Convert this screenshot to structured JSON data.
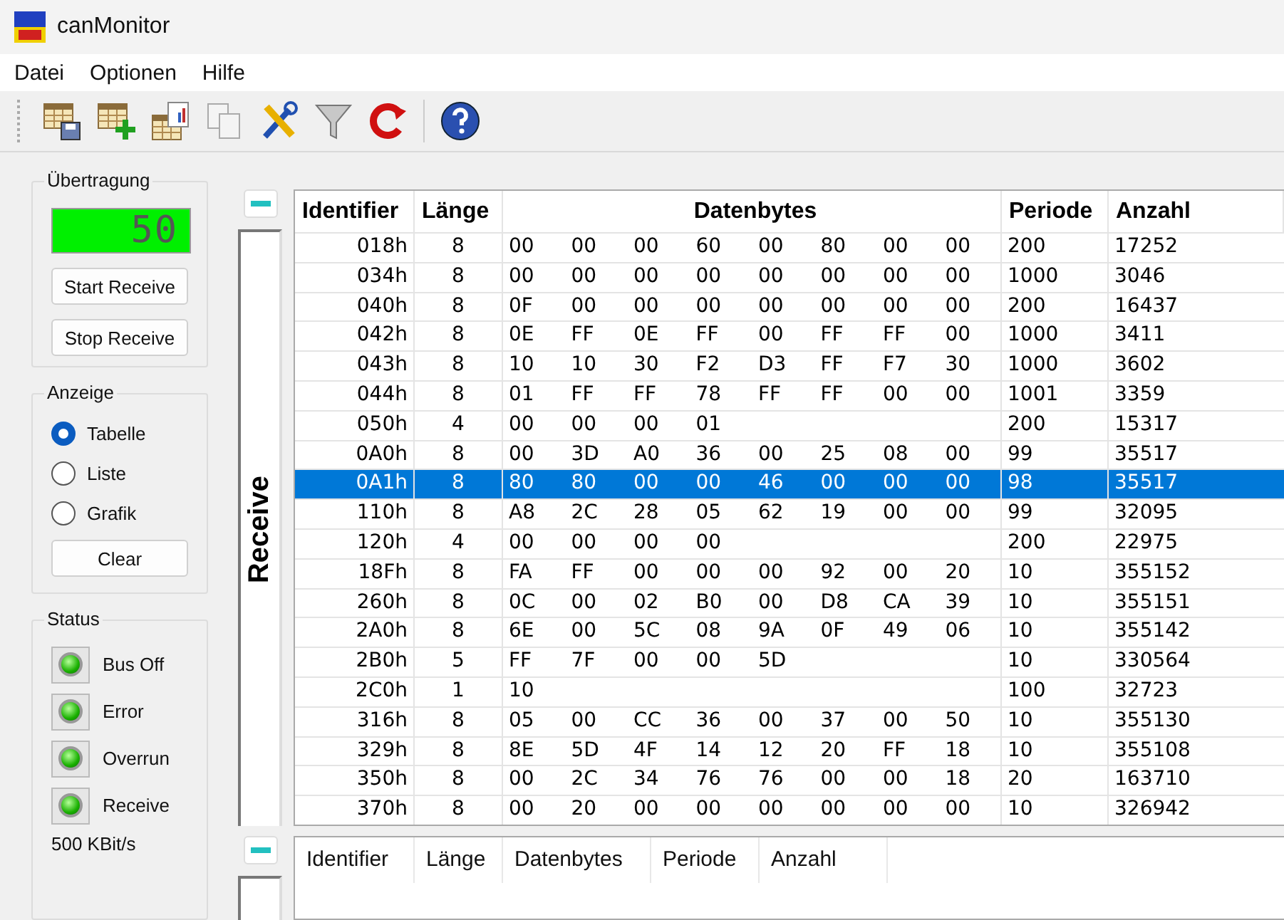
{
  "window": {
    "title": "canMonitor"
  },
  "menu": [
    "Datei",
    "Optionen",
    "Hilfe"
  ],
  "transfer": {
    "title": "Übertragung",
    "display": "50",
    "buttons": [
      "Start Receive",
      "Stop Receive"
    ]
  },
  "view": {
    "title": "Anzeige",
    "options": [
      {
        "label": "Tabelle",
        "selected": true
      },
      {
        "label": "Liste",
        "selected": false
      },
      {
        "label": "Grafik",
        "selected": false
      }
    ],
    "button": "Clear"
  },
  "status": {
    "title": "Status",
    "leds": [
      {
        "label": "Bus Off",
        "on": true
      },
      {
        "label": "Error",
        "on": true
      },
      {
        "label": "Overrun",
        "on": true
      },
      {
        "label": "Receive",
        "on": true
      }
    ],
    "baud": "500 KBit/s"
  },
  "receive_tab": {
    "label": "Receive"
  },
  "table": {
    "columns": [
      "Identifier",
      "Länge",
      "Datenbytes",
      "Periode",
      "Anzahl"
    ],
    "rows": [
      {
        "id": "018h",
        "len": "8",
        "bytes": [
          "00",
          "00",
          "00",
          "60",
          "00",
          "80",
          "00",
          "00"
        ],
        "period": "200",
        "count": "17252",
        "selected": false
      },
      {
        "id": "034h",
        "len": "8",
        "bytes": [
          "00",
          "00",
          "00",
          "00",
          "00",
          "00",
          "00",
          "00"
        ],
        "period": "1000",
        "count": "3046",
        "selected": false
      },
      {
        "id": "040h",
        "len": "8",
        "bytes": [
          "0F",
          "00",
          "00",
          "00",
          "00",
          "00",
          "00",
          "00"
        ],
        "period": "200",
        "count": "16437",
        "selected": false
      },
      {
        "id": "042h",
        "len": "8",
        "bytes": [
          "0E",
          "FF",
          "0E",
          "FF",
          "00",
          "FF",
          "FF",
          "00"
        ],
        "period": "1000",
        "count": "3411",
        "selected": false
      },
      {
        "id": "043h",
        "len": "8",
        "bytes": [
          "10",
          "10",
          "30",
          "F2",
          "D3",
          "FF",
          "F7",
          "30"
        ],
        "period": "1000",
        "count": "3602",
        "selected": false
      },
      {
        "id": "044h",
        "len": "8",
        "bytes": [
          "01",
          "FF",
          "FF",
          "78",
          "FF",
          "FF",
          "00",
          "00"
        ],
        "period": "1001",
        "count": "3359",
        "selected": false
      },
      {
        "id": "050h",
        "len": "4",
        "bytes": [
          "00",
          "00",
          "00",
          "01"
        ],
        "period": "200",
        "count": "15317",
        "selected": false
      },
      {
        "id": "0A0h",
        "len": "8",
        "bytes": [
          "00",
          "3D",
          "A0",
          "36",
          "00",
          "25",
          "08",
          "00"
        ],
        "period": "99",
        "count": "35517",
        "selected": false
      },
      {
        "id": "0A1h",
        "len": "8",
        "bytes": [
          "80",
          "80",
          "00",
          "00",
          "46",
          "00",
          "00",
          "00"
        ],
        "period": "98",
        "count": "35517",
        "selected": true
      },
      {
        "id": "110h",
        "len": "8",
        "bytes": [
          "A8",
          "2C",
          "28",
          "05",
          "62",
          "19",
          "00",
          "00"
        ],
        "period": "99",
        "count": "32095",
        "selected": false
      },
      {
        "id": "120h",
        "len": "4",
        "bytes": [
          "00",
          "00",
          "00",
          "00"
        ],
        "period": "200",
        "count": "22975",
        "selected": false
      },
      {
        "id": "18Fh",
        "len": "8",
        "bytes": [
          "FA",
          "FF",
          "00",
          "00",
          "00",
          "92",
          "00",
          "20"
        ],
        "period": "10",
        "count": "355152",
        "selected": false
      },
      {
        "id": "260h",
        "len": "8",
        "bytes": [
          "0C",
          "00",
          "02",
          "B0",
          "00",
          "D8",
          "CA",
          "39"
        ],
        "period": "10",
        "count": "355151",
        "selected": false
      },
      {
        "id": "2A0h",
        "len": "8",
        "bytes": [
          "6E",
          "00",
          "5C",
          "08",
          "9A",
          "0F",
          "49",
          "06"
        ],
        "period": "10",
        "count": "355142",
        "selected": false
      },
      {
        "id": "2B0h",
        "len": "5",
        "bytes": [
          "FF",
          "7F",
          "00",
          "00",
          "5D"
        ],
        "period": "10",
        "count": "330564",
        "selected": false
      },
      {
        "id": "2C0h",
        "len": "1",
        "bytes": [
          "10"
        ],
        "period": "100",
        "count": "32723",
        "selected": false
      },
      {
        "id": "316h",
        "len": "8",
        "bytes": [
          "05",
          "00",
          "CC",
          "36",
          "00",
          "37",
          "00",
          "50"
        ],
        "period": "10",
        "count": "355130",
        "selected": false
      },
      {
        "id": "329h",
        "len": "8",
        "bytes": [
          "8E",
          "5D",
          "4F",
          "14",
          "12",
          "20",
          "FF",
          "18"
        ],
        "period": "10",
        "count": "355108",
        "selected": false
      },
      {
        "id": "350h",
        "len": "8",
        "bytes": [
          "00",
          "2C",
          "34",
          "76",
          "76",
          "00",
          "00",
          "18"
        ],
        "period": "20",
        "count": "163710",
        "selected": false
      },
      {
        "id": "370h",
        "len": "8",
        "bytes": [
          "00",
          "20",
          "00",
          "00",
          "00",
          "00",
          "00",
          "00"
        ],
        "period": "10",
        "count": "326942",
        "selected": false
      }
    ]
  },
  "list_table": {
    "columns": [
      "Identifier",
      "Länge",
      "Datenbytes",
      "Periode",
      "Anzahl"
    ]
  }
}
